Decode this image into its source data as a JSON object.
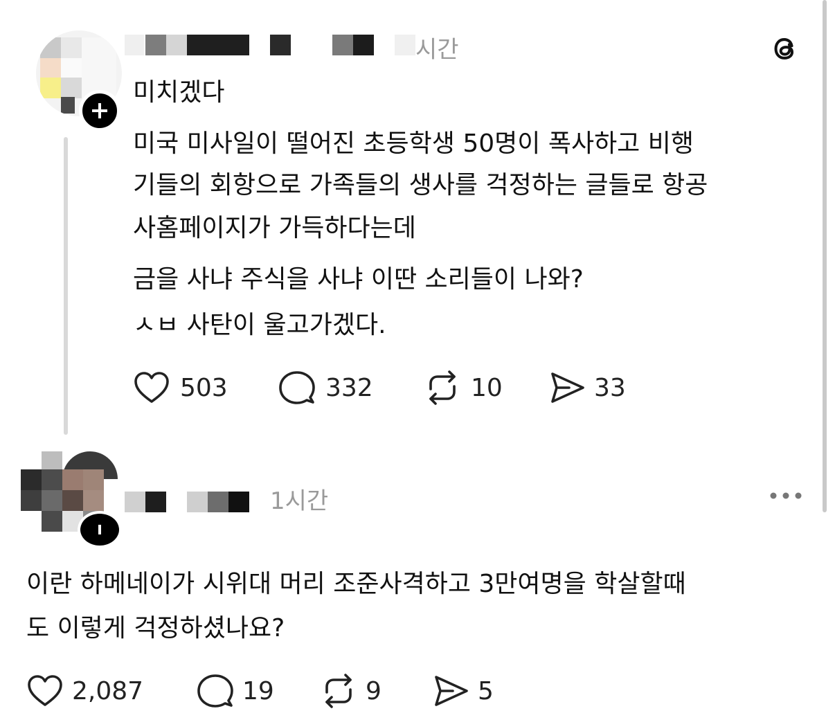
{
  "post1": {
    "time": "시간",
    "lines": [
      "미치겠다",
      "미국 미사일이 떨어진 초등학생 50명이 폭사하고 비행",
      "기들의 회항으로 가족들의 생사를 걱정하는 글들로 항공",
      "사홈페이지가 가득하다는데",
      "금을 사냐 주식을 사냐 이딴 소리들이 나와?",
      "ㅅㅂ 사탄이 울고가겠다."
    ],
    "likes": "503",
    "replies": "332",
    "reposts": "10",
    "shares": "33"
  },
  "post2": {
    "time": "1시간",
    "lines": [
      "이란 하메네이가 시위대 머리 조준사격하고 3만여명을 학살할때",
      "도 이렇게 걱정하셨나요?"
    ],
    "likes": "2,087",
    "replies": "19",
    "reposts": "9",
    "shares": "5"
  },
  "icons": {
    "like": "heart-icon",
    "reply": "comment-bubble-icon",
    "repost": "repost-icon",
    "share": "send-icon",
    "brand": "threads-logo-icon",
    "more": "more-dots-icon",
    "follow": "plus-icon"
  },
  "colors": {
    "text": "#111111",
    "muted": "#9a9a9a",
    "thread_line": "#d9d9d9"
  }
}
